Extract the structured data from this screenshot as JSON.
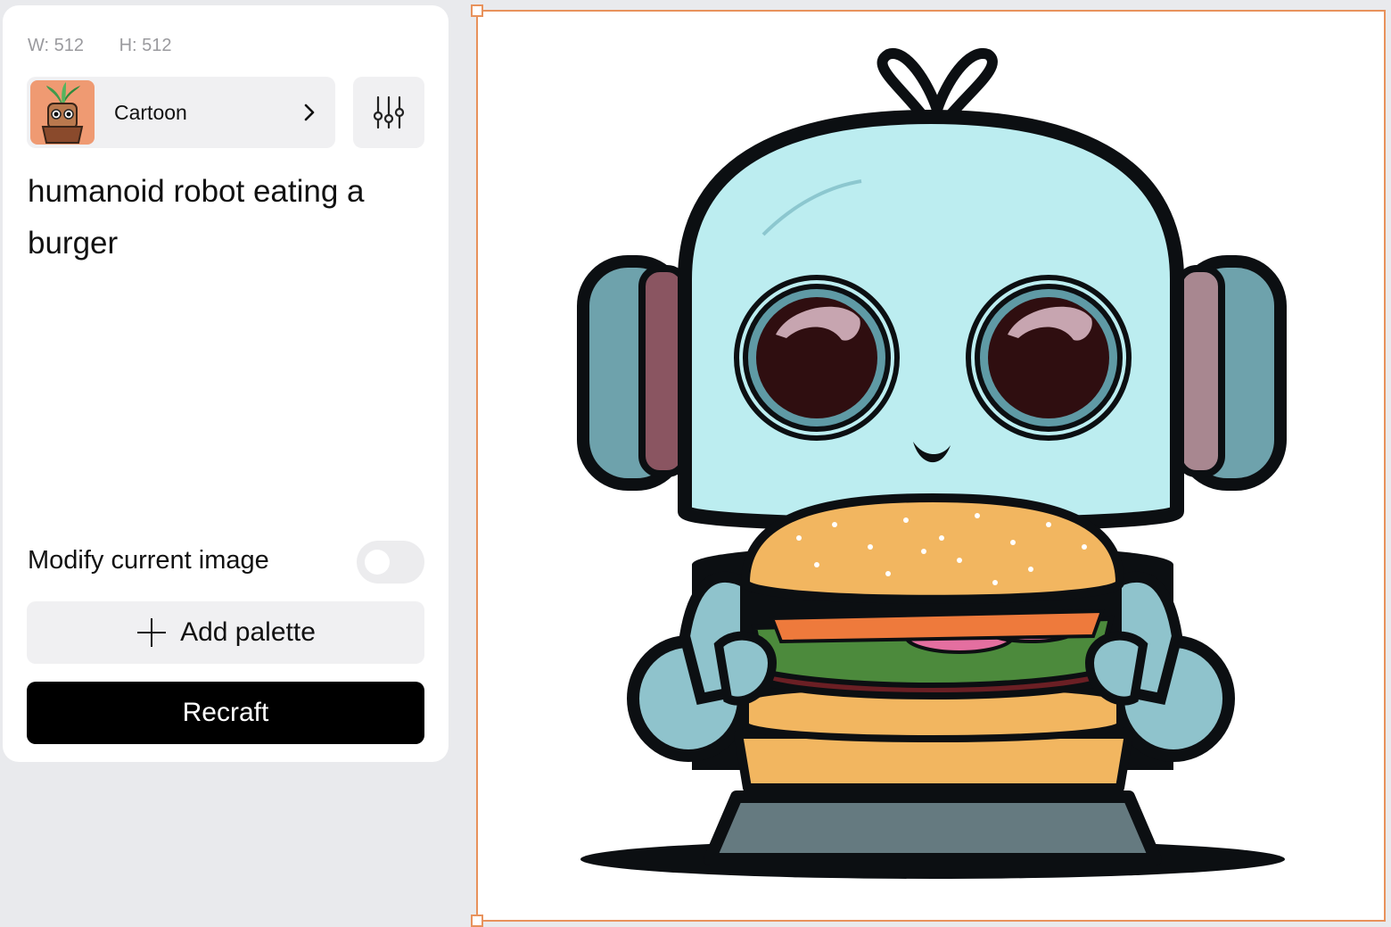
{
  "dimensions": {
    "width": "W: 512",
    "height": "H: 512"
  },
  "style": {
    "label": "Cartoon",
    "thumbnail_icon": "potted-plant-character-icon"
  },
  "settings": {
    "icon": "sliders-icon"
  },
  "prompt": {
    "text": "humanoid robot eating a burger"
  },
  "modify": {
    "label": "Modify current image",
    "enabled": false
  },
  "palette": {
    "label": "Add palette",
    "icon": "plus-icon"
  },
  "recraft": {
    "label": "Recraft"
  },
  "canvas": {
    "image": "cartoon-robot-eating-burger",
    "selected": true
  },
  "colors": {
    "selection": "#e8925c",
    "accent_button": "#000000",
    "panel_bg": "#ffffff",
    "app_bg": "#e9eaed"
  }
}
